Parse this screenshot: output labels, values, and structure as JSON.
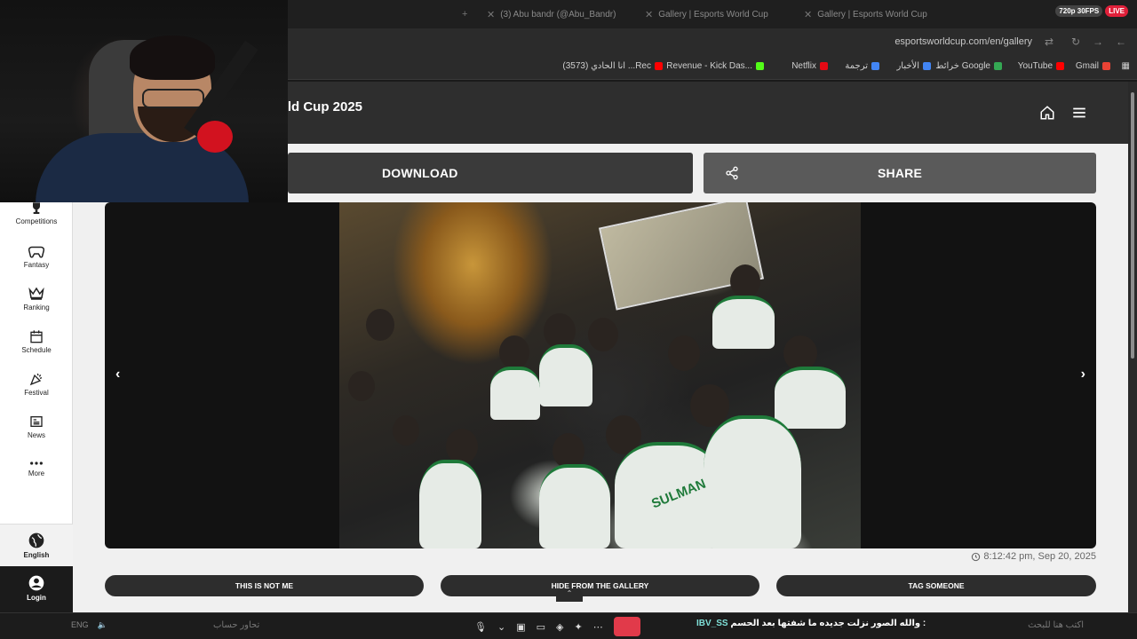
{
  "browser": {
    "tabs": [
      {
        "label": "(3) Abu bandr (@Abu_Bandr)"
      },
      {
        "label": "Gallery | Esports World Cup"
      },
      {
        "label": "Gallery | Esports World Cup"
      }
    ],
    "stream_badge_quality": "720p 30FPS",
    "stream_badge_live": "LIVE",
    "url": "esportsworldcup.com/en/gallery",
    "bookmarks": [
      {
        "label": "Gmail",
        "color": "#ea4335"
      },
      {
        "label": "YouTube",
        "color": "#ff0000"
      },
      {
        "label": "خرائط Google",
        "color": "#34a853"
      },
      {
        "label": "الأخبار",
        "color": "#4285f4"
      },
      {
        "label": "ترجمة",
        "color": "#4285f4"
      },
      {
        "label": "Netflix",
        "color": "#e50914"
      },
      {
        "label": "Revenue - Kick Das...",
        "color": "#53fc18"
      },
      {
        "label": "(3573) انا الحادي ...Rec",
        "color": "#ff0000"
      }
    ]
  },
  "site": {
    "title": "rld Cup 2025",
    "download_label": "DOWNLOAD",
    "share_label": "SHARE",
    "timestamp": "8:12:42 pm, Sep 20, 2025",
    "actions": {
      "not_me": "THIS IS NOT ME",
      "hide": "HIDE FROM THE GALLERY",
      "tag": "TAG SOMEONE"
    },
    "jersey_text": "SULMAN"
  },
  "sidebar": {
    "items": [
      {
        "label": "Competitions",
        "icon": "trophy-icon"
      },
      {
        "label": "Fantasy",
        "icon": "gamepad-icon"
      },
      {
        "label": "Ranking",
        "icon": "crown-icon"
      },
      {
        "label": "Schedule",
        "icon": "calendar-icon"
      },
      {
        "label": "Festival",
        "icon": "party-icon"
      },
      {
        "label": "News",
        "icon": "news-icon"
      },
      {
        "label": "More",
        "icon": "more-icon"
      }
    ],
    "language": "English",
    "login": "Login"
  },
  "taskbar": {
    "left_text": "ENG",
    "search_placeholder": "تحاور حساب",
    "chat_nick": "IBV_SS",
    "chat_message": "والله الصور نزلت جديده ما شفتها بعد الحسم :",
    "right_text": "اكتب هنا للبحث"
  },
  "colors": {
    "accent_live": "#e0203a",
    "jersey_green": "#1f7a3a",
    "dark_button": "#3a3a3a",
    "share_button": "#5a5a5a"
  }
}
